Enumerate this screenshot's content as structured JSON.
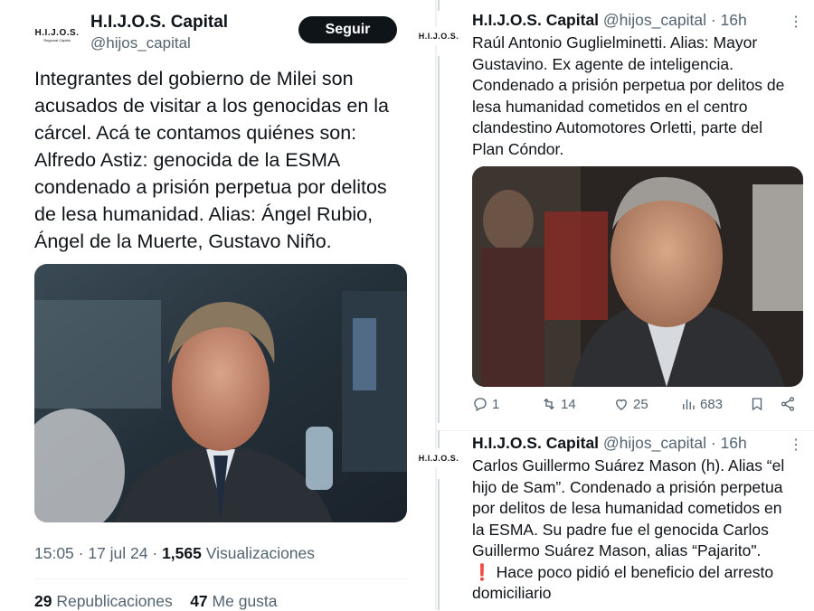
{
  "left": {
    "logo_text": "H.I.J.O.S.",
    "logo_sub": "Regional Capital",
    "name": "H.I.J.O.S. Capital",
    "handle": "@hijos_capital",
    "follow_label": "Seguir",
    "text": "Integrantes del gobierno de Milei son\nacusados de visitar a los genocidas en la\ncárcel. Acá te contamos quiénes son:\nAlfredo Astiz: genocida de la ESMA\ncondenado a prisión perpetua por delitos\nde lesa humanidad. Alias: Ángel Rubio,\nÁngel de la Muerte, Gustavo Niño.",
    "time": "15:05 · 17 jul 24 · ",
    "views_count": "1,565",
    "views_label": " Visualizaciones",
    "reposts_count": "29",
    "reposts_label": " Republicaciones",
    "likes_count": "47",
    "likes_label": " Me gusta"
  },
  "right": {
    "tweet1": {
      "logo_text": "H.I.J.O.S.",
      "name": "H.I.J.O.S. Capital",
      "handle": " @hijos_capital · 16h",
      "text": "Raúl Antonio Guglielminetti. Alias: Mayor\nGustavino. Ex agente de inteligencia.\nCondenado a prisión perpetua por delitos de\nlesa humanidad cometidos en el centro\nclandestino Automotores Orletti, parte del\nPlan Cóndor.",
      "replies": "1",
      "reposts": "14",
      "likes": "25",
      "views": "683"
    },
    "tweet2": {
      "logo_text": "H.I.J.O.S.",
      "name": "H.I.J.O.S. Capital",
      "handle": " @hijos_capital · 16h",
      "text": "Carlos Guillermo Suárez Mason (h). Alias “el\nhijo de Sam”. Condenado a prisión perpetua\npor delitos de lesa humanidad cometidos en\nla ESMA. Su padre fue el genocida Carlos\nGuillermo Suárez Mason, alias “Pajarito\".\n❗ Hace poco pidió el beneficio del arresto\ndomiciliario"
    },
    "more_glyph": "⋮"
  },
  "colors": {
    "text": "#0f1419",
    "muted": "#536471",
    "follow_bg": "#0f1419"
  }
}
